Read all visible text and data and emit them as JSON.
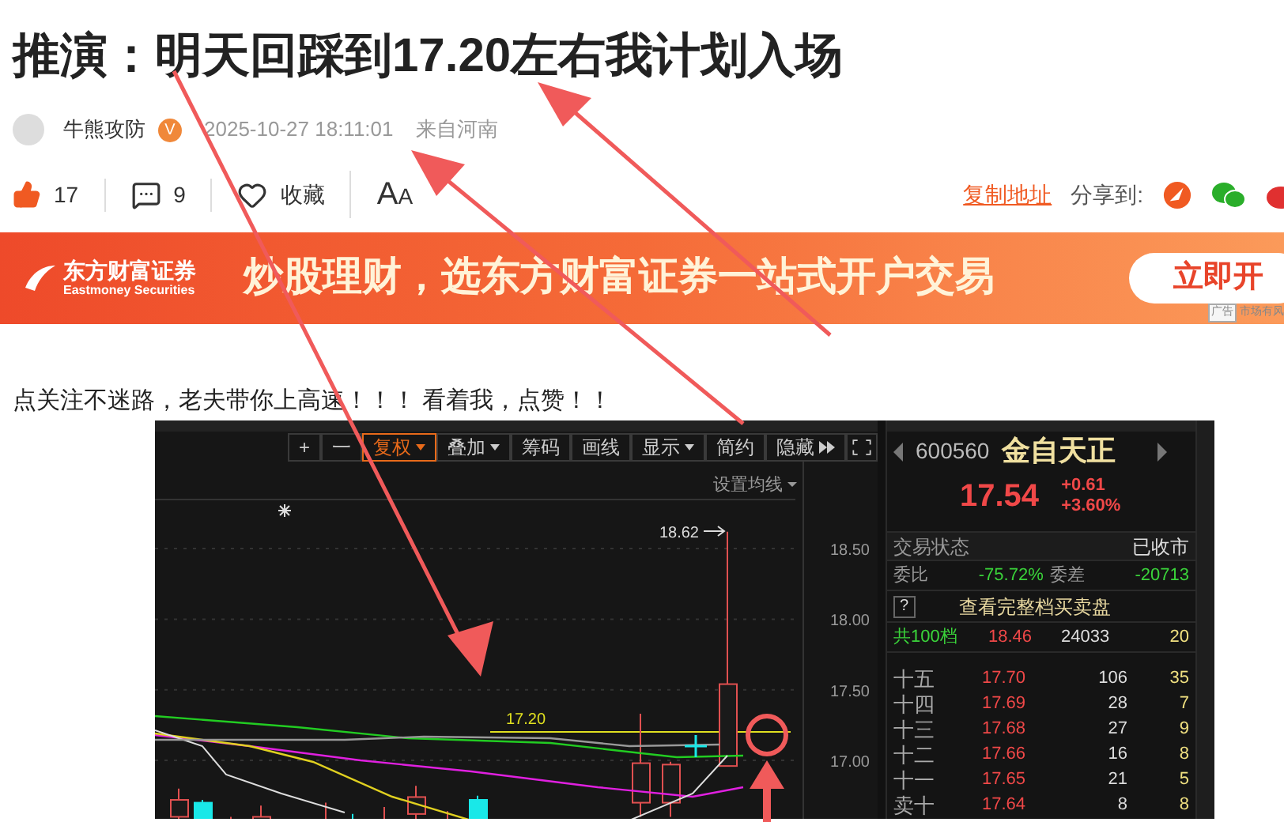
{
  "title": "推演：明天回踩到17.20左右我计划入场",
  "author": {
    "name": "牛熊攻防",
    "badge": "V",
    "time": "2025-10-27 18:11:01",
    "location": "来自河南"
  },
  "actions": [
    {
      "kind": "like",
      "label": "17"
    },
    {
      "kind": "comment",
      "label": "9"
    },
    {
      "kind": "favorite",
      "label": "收藏"
    },
    {
      "kind": "font",
      "label": "A",
      "label_small": "A"
    }
  ],
  "share": {
    "copy_link": "复制地址",
    "label": "分享到:"
  },
  "banner": {
    "brand": "东方财富证券",
    "brand_en": "Eastmoney Securities",
    "slogan": "炒股理财，选东方财富证券一站式开户交易",
    "button": "立即开",
    "ad_tag": "广告",
    "ad_note": "市场有风"
  },
  "post_text": "点关注不迷路，老夫带你上高速！！！ 看着我，点赞！！",
  "chart": {
    "toolbar": [
      {
        "label": "+",
        "dropdown": false,
        "selected": false
      },
      {
        "label": "一",
        "dropdown": false,
        "selected": false
      },
      {
        "label": "复权",
        "dropdown": true,
        "selected": true
      },
      {
        "label": "叠加",
        "dropdown": true,
        "selected": false
      },
      {
        "label": "筹码",
        "dropdown": false,
        "selected": false
      },
      {
        "label": "画线",
        "dropdown": false,
        "selected": false
      },
      {
        "label": "显示",
        "dropdown": true,
        "selected": false
      },
      {
        "label": "简约",
        "dropdown": false,
        "selected": false
      },
      {
        "label": "隐藏",
        "dropdown": false,
        "selected": false
      }
    ],
    "ma_setting": "设置均线",
    "high_label": "18.62",
    "line_label": "17.20",
    "price_ticks": [
      "18.50",
      "18.00",
      "17.50",
      "17.00"
    ]
  },
  "quote": {
    "code": "600560",
    "name": "金自天正",
    "price": "17.54",
    "change": "+0.61",
    "change_pct": "+3.60%",
    "status_label": "交易状态",
    "status": "已收市",
    "ratio_label": "委比",
    "ratio": "-75.72%",
    "diff_label": "委差",
    "diff": "-20713",
    "help": "?",
    "full_book": "查看完整档买卖盘",
    "total": {
      "label": "共100档",
      "price": "18.46",
      "volume": "24033",
      "count": "20"
    },
    "levels": [
      {
        "label": "十五",
        "price": "17.70",
        "volume": "106",
        "count": "35"
      },
      {
        "label": "十四",
        "price": "17.69",
        "volume": "28",
        "count": "7"
      },
      {
        "label": "十三",
        "price": "17.68",
        "volume": "27",
        "count": "9"
      },
      {
        "label": "十二",
        "price": "17.66",
        "volume": "16",
        "count": "8"
      },
      {
        "label": "十一",
        "price": "17.65",
        "volume": "21",
        "count": "5"
      },
      {
        "label": "卖十",
        "price": "17.64",
        "volume": "8",
        "count": "8"
      }
    ]
  }
}
